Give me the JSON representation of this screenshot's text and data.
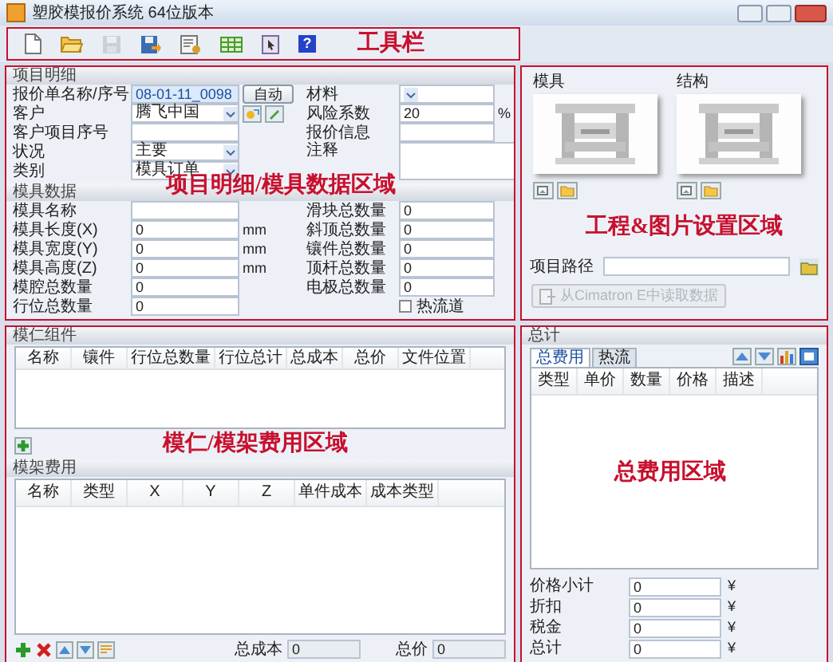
{
  "window": {
    "title": "塑胶模报价系统 64位版本"
  },
  "toolbar": {
    "annotation": "工具栏",
    "buttons": [
      {
        "kind": "new",
        "disabled": false
      },
      {
        "kind": "open",
        "disabled": false
      },
      {
        "kind": "save",
        "disabled": true
      },
      {
        "kind": "export",
        "disabled": false
      },
      {
        "kind": "settings",
        "disabled": false
      },
      {
        "kind": "table",
        "disabled": false
      },
      {
        "kind": "report",
        "disabled": false
      },
      {
        "kind": "help",
        "disabled": false,
        "label": "?"
      }
    ]
  },
  "project": {
    "title": "项目明细",
    "annotation": "项目明细/模具数据区域",
    "left": [
      {
        "label": "报价单名称/序号",
        "kind": "text",
        "value": "08-01-11_0098",
        "button": "自动"
      },
      {
        "label": "客户",
        "kind": "combo-tools",
        "value": "腾飞中国"
      },
      {
        "label": "客户项目序号",
        "kind": "text"
      },
      {
        "label": "状况",
        "kind": "combo",
        "value": "主要"
      },
      {
        "label": "类别",
        "kind": "combo",
        "value": "模具订单"
      }
    ],
    "right": [
      {
        "label": "材料",
        "kind": "combo"
      },
      {
        "label": "风险系数",
        "kind": "text",
        "value": "20",
        "unit": "%"
      },
      {
        "label": "报价信息",
        "kind": "text"
      },
      {
        "label": "注释",
        "kind": "memo"
      }
    ]
  },
  "mold": {
    "title": "模具数据",
    "left": [
      {
        "label": "模具名称",
        "kind": "text"
      },
      {
        "label": "模具长度(X)",
        "kind": "text",
        "value": "0",
        "unit": "mm"
      },
      {
        "label": "模具宽度(Y)",
        "kind": "text",
        "value": "0",
        "unit": "mm"
      },
      {
        "label": "模具高度(Z)",
        "kind": "text",
        "value": "0",
        "unit": "mm"
      },
      {
        "label": "模腔总数量",
        "kind": "text",
        "value": "0"
      },
      {
        "label": "行位总数量",
        "kind": "text",
        "value": "0"
      }
    ],
    "right": [
      {
        "label": "滑块总数量",
        "kind": "text",
        "value": "0"
      },
      {
        "label": "斜顶总数量",
        "kind": "text",
        "value": "0"
      },
      {
        "label": "镶件总数量",
        "kind": "text",
        "value": "0"
      },
      {
        "label": "顶杆总数量",
        "kind": "text",
        "value": "0"
      },
      {
        "label": "电极总数量",
        "kind": "text",
        "value": "0"
      },
      {
        "label": "热流道",
        "kind": "checkbox",
        "checked": false
      }
    ]
  },
  "images": {
    "annotation": "工程&图片设置区域",
    "pictures": [
      {
        "label": "模具",
        "kind": "picture"
      },
      {
        "label": "结构",
        "kind": "picture"
      }
    ],
    "path_label": "项目路径",
    "import_button": {
      "label": "从Cimatron E中读取数据",
      "disabled": true
    }
  },
  "core": {
    "title": "模仁组件",
    "annotation": "模仁/模架费用区域",
    "columns": [
      "名称",
      "镶件",
      "行位总数量",
      "行位总计",
      "总成本",
      "总价",
      "文件位置"
    ]
  },
  "frame": {
    "title": "模架费用",
    "columns": [
      "名称",
      "类型",
      "X",
      "Y",
      "Z",
      "单件成本",
      "成本类型"
    ],
    "total_cost_label": "总成本",
    "total_cost": "0",
    "total_price_label": "总价",
    "total_price": "0"
  },
  "summary": {
    "title": "总计",
    "annotation": "总费用区域",
    "tabs": [
      {
        "label": "总费用",
        "selected": true
      },
      {
        "label": "热流",
        "selected": false
      }
    ],
    "columns": [
      "类型",
      "单价",
      "数量",
      "价格",
      "描述"
    ],
    "totals": [
      {
        "label": "价格小计",
        "value": "0",
        "unit": "¥"
      },
      {
        "label": "折扣",
        "value": "0",
        "unit": "¥"
      },
      {
        "label": "税金",
        "value": "0",
        "unit": "¥"
      },
      {
        "label": "总计",
        "value": "0",
        "unit": "¥"
      }
    ]
  }
}
